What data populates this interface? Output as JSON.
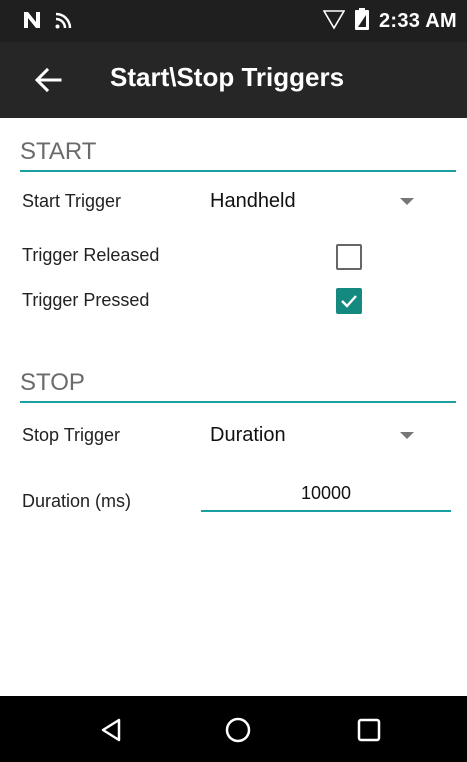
{
  "status_bar": {
    "time": "2:33 AM",
    "icons": [
      "n-icon",
      "wifi-icon",
      "signal-icon",
      "battery-icon"
    ]
  },
  "app_bar": {
    "title": "Start\\Stop Triggers",
    "back_icon": "arrow-left-icon"
  },
  "start_section": {
    "header": "START",
    "start_trigger_label": "Start Trigger",
    "start_trigger_value": "Handheld",
    "trigger_released_label": "Trigger Released",
    "trigger_released_checked": false,
    "trigger_pressed_label": "Trigger Pressed",
    "trigger_pressed_checked": true
  },
  "stop_section": {
    "header": "STOP",
    "stop_trigger_label": "Stop Trigger",
    "stop_trigger_value": "Duration",
    "duration_label": "Duration (ms)",
    "duration_value": "10000"
  },
  "nav_bar": {
    "icons": [
      "back-triangle-icon",
      "home-circle-icon",
      "recents-square-icon"
    ]
  },
  "colors": {
    "accent": "#1aa0a0",
    "checkbox_checked": "#13897f",
    "appbar": "#262626"
  }
}
